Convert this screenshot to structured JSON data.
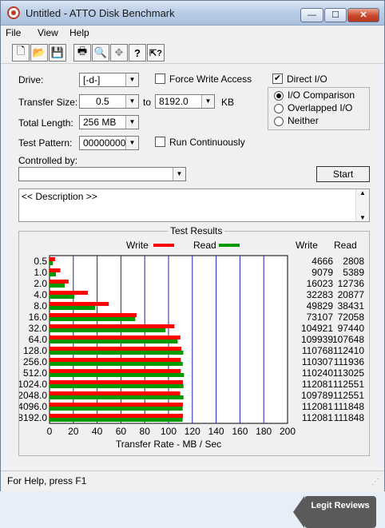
{
  "window": {
    "title": "Untitled - ATTO Disk Benchmark",
    "min": "—",
    "max": "☐",
    "close": "✕"
  },
  "menu": [
    "File",
    "View",
    "Help"
  ],
  "toolbar": [
    {
      "name": "new-file-icon",
      "glyph": "🗋"
    },
    {
      "name": "open-folder-icon",
      "glyph": "📂"
    },
    {
      "name": "save-icon",
      "glyph": "💾"
    },
    {
      "name": "print-icon",
      "glyph": "🖶"
    },
    {
      "name": "print-preview-icon",
      "glyph": "🔍"
    },
    {
      "name": "move-icon",
      "glyph": "✥"
    },
    {
      "name": "help-icon",
      "glyph": "?"
    },
    {
      "name": "context-help-icon",
      "glyph": "⇱?"
    }
  ],
  "form": {
    "drive_label": "Drive:",
    "drive_value": "[-d-]",
    "force_write_label": "Force Write Access",
    "direct_io_label": "Direct I/O",
    "direct_io_checked": "✔",
    "transfer_size_label": "Transfer Size:",
    "transfer_from": "0.5",
    "to_label": "to",
    "transfer_to": "8192.0",
    "kb_label": "KB",
    "total_length_label": "Total Length:",
    "total_length_value": "256 MB",
    "test_pattern_label": "Test Pattern:",
    "test_pattern_value": "00000000",
    "run_continuously_label": "Run Continuously",
    "controlled_by_label": "Controlled by:",
    "controlled_by_value": "",
    "start_label": "Start",
    "description_text": "<< Description >>",
    "io_options": [
      "I/O Comparison",
      "Overlapped I/O",
      "Neither"
    ],
    "io_selected": 0
  },
  "results": {
    "group_title": "Test Results",
    "write_label": "Write",
    "read_label": "Read",
    "col_write": "Write",
    "col_read": "Read",
    "write_color": "#ff0000",
    "read_color": "#009a00",
    "rows": [
      {
        "size": "0.5",
        "write": "4666",
        "read": "2808"
      },
      {
        "size": "1.0",
        "write": "9079",
        "read": "5389"
      },
      {
        "size": "2.0",
        "write": "16023",
        "read": "12736"
      },
      {
        "size": "4.0",
        "write": "32283",
        "read": "20877"
      },
      {
        "size": "8.0",
        "write": "49829",
        "read": "38431"
      },
      {
        "size": "16.0",
        "write": "73107",
        "read": "72058"
      },
      {
        "size": "32.0",
        "write": "104921",
        "read": "97440"
      },
      {
        "size": "64.0",
        "write": "109939",
        "read": "107648"
      },
      {
        "size": "128.0",
        "write": "110768",
        "read": "112410"
      },
      {
        "size": "256.0",
        "write": "110307",
        "read": "111936"
      },
      {
        "size": "512.0",
        "write": "110240",
        "read": "113025"
      },
      {
        "size": "1024.0",
        "write": "112081",
        "read": "112551"
      },
      {
        "size": "2048.0",
        "write": "109789",
        "read": "112551"
      },
      {
        "size": "4096.0",
        "write": "112081",
        "read": "111848"
      },
      {
        "size": "8192.0",
        "write": "112081",
        "read": "111848"
      }
    ]
  },
  "chart_data": {
    "type": "bar",
    "orientation": "horizontal",
    "categories": [
      "0.5",
      "1.0",
      "2.0",
      "4.0",
      "8.0",
      "16.0",
      "32.0",
      "64.0",
      "128.0",
      "256.0",
      "512.0",
      "1024.0",
      "2048.0",
      "4096.0",
      "8192.0"
    ],
    "series": [
      {
        "name": "Write",
        "values": [
          4.666,
          9.079,
          16.023,
          32.283,
          49.829,
          73.107,
          104.921,
          109.939,
          110.768,
          110.307,
          110.24,
          112.081,
          109.789,
          112.081,
          112.081
        ]
      },
      {
        "name": "Read",
        "values": [
          2.808,
          5.389,
          12.736,
          20.877,
          38.431,
          72.058,
          97.44,
          107.648,
          112.41,
          111.936,
          113.025,
          112.551,
          112.551,
          111.848,
          111.848
        ]
      }
    ],
    "xlabel": "Transfer Rate - MB / Sec",
    "xticks": [
      "0",
      "20",
      "40",
      "60",
      "80",
      "100",
      "120",
      "140",
      "160",
      "180",
      "200"
    ],
    "xlim": [
      0,
      200
    ],
    "grid": true
  },
  "status": {
    "text": "For Help, press F1"
  },
  "logo": {
    "text": "Legit Reviews"
  }
}
